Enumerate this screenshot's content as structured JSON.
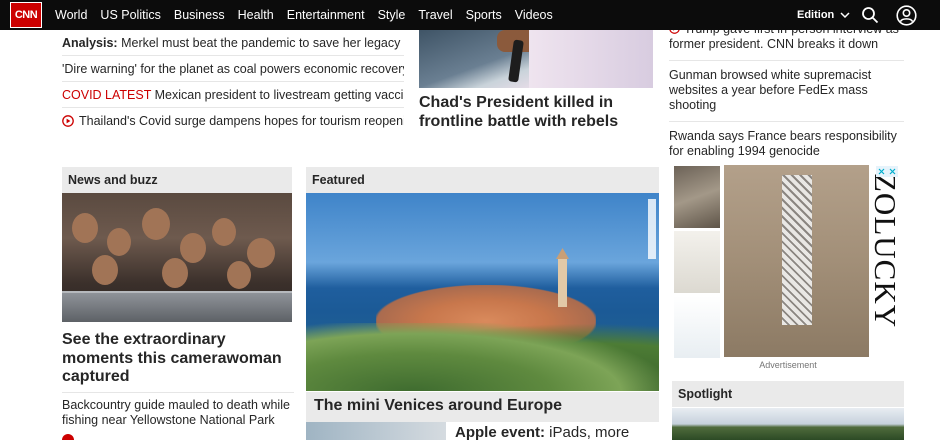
{
  "nav": {
    "logo": "CNN",
    "links": [
      "World",
      "US Politics",
      "Business",
      "Health",
      "Entertainment",
      "Style",
      "Travel",
      "Sports",
      "Videos"
    ],
    "edition": "Edition"
  },
  "top_left": {
    "analysis_label": "Analysis:",
    "analysis_text": "Merkel must beat the pandemic to save her legacy",
    "item2": "'Dire warning' for the planet as coal powers economic recovery",
    "covid_label": "COVID LATEST",
    "covid_text": "Mexican president to livestream getting vaccinated",
    "item4": "Thailand's Covid surge dampens hopes for tourism reopening"
  },
  "top_mid": {
    "headline": "Chad's President killed in frontline battle with rebels"
  },
  "top_right": {
    "item1": "Trump gave first in-person interview as former president. CNN breaks it down",
    "item2": "Gunman browsed white supremacist websites a year before FedEx mass shooting",
    "item3": "Rwanda says France bears responsibility for enabling 1994 genocide"
  },
  "news_buzz": {
    "header": "News and buzz",
    "headline": "See the extraordinary moments this camerawoman captured",
    "sub": "Backcountry guide mauled to death while fishing near Yellowstone National Park"
  },
  "featured": {
    "header": "Featured",
    "headline": "The mini Venices around Europe",
    "sub_bold": "Apple event:",
    "sub_rest": " iPads, more"
  },
  "ad": {
    "brand": "ZOLUCKY",
    "label": "Advertisement"
  },
  "spotlight": {
    "header": "Spotlight"
  }
}
